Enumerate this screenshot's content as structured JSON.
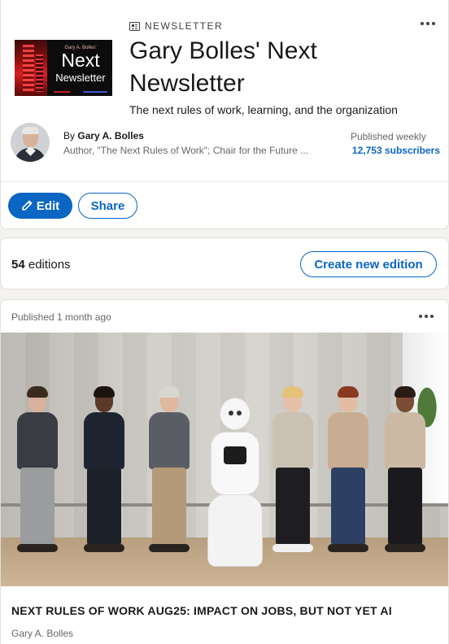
{
  "newsletter": {
    "label": "NEWSLETTER",
    "title": "Gary Bolles' Next Newsletter",
    "tagline": "The next rules of work, learning, and the organization",
    "logo": {
      "small_text": "Gary A. Bolles'",
      "big_text": "Next",
      "mid_text": "Newsletter"
    }
  },
  "author": {
    "by_prefix": "By",
    "name": "Gary A. Bolles",
    "headline": "Author, \"The Next Rules of Work\"; Chair for the Future ..."
  },
  "stats": {
    "frequency": "Published weekly",
    "subscribers": "12,753 subscribers"
  },
  "actions": {
    "edit_label": "Edit",
    "share_label": "Share"
  },
  "editions": {
    "count": "54",
    "label": "editions",
    "create_label": "Create new edition"
  },
  "post": {
    "published": "Published 1 month ago",
    "title": "NEXT RULES OF WORK AUG25: IMPACT ON JOBS, BUT NOT YET AI",
    "author": "Gary A. Bolles"
  },
  "colors": {
    "accent": "#0a66c2",
    "text_secondary": "#666666",
    "background": "#f4f2ee"
  },
  "icons": [
    "newsletter-icon",
    "more-options-icon",
    "pencil-icon"
  ]
}
